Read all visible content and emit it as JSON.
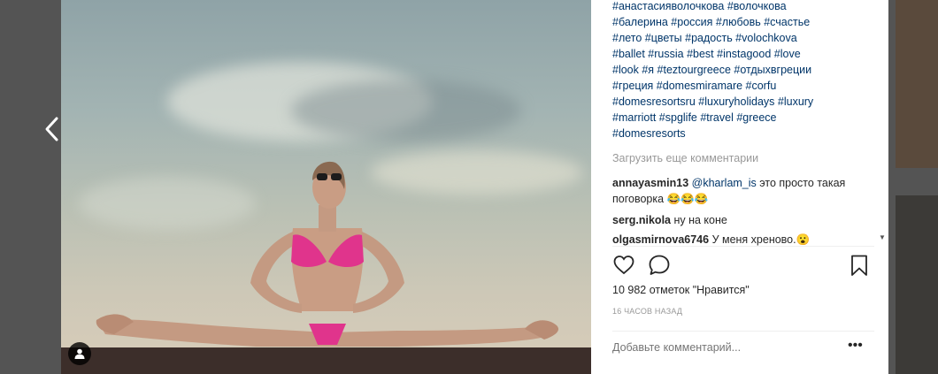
{
  "caption_lines": [
    "#анастасияволочкова #волочкова",
    "#балерина #россия #любовь #счастье",
    "#лето #цветы #радость #volochkova",
    "#ballet #russia #best #instagood #love",
    "#look #я #teztourgreece #отдыхвгреции",
    "#греция #domesmiramare #corfu",
    "#domesresortsru #luxuryholidays #luxury",
    "#marriott #spglife #travel #greece",
    "#domesresorts"
  ],
  "load_more": "Загрузить еще комментарии",
  "comments": [
    {
      "user": "annayasmin13",
      "mention": "@kharlam_is",
      "text": " это просто такая поговорка 😂😂😂"
    },
    {
      "user": "serg.nikola",
      "text": " ну на коне"
    },
    {
      "user": "olgasmirnova6746",
      "text": " У меня хреново.😮"
    }
  ],
  "likes": "10 982 отметок \"Нравится\"",
  "time": "16 ЧАСОВ НАЗАД",
  "add_comment_placeholder": "Добавьте комментарий...",
  "more_label": "•••",
  "icons": {
    "prev": "chevron-left-icon",
    "next": "chevron-right-icon",
    "like": "heart-icon",
    "comment": "speech-bubble-icon",
    "save": "bookmark-icon",
    "user_tag": "person-icon"
  },
  "colors": {
    "hashtag": "#003569",
    "text": "#262626",
    "muted": "#999999",
    "backdrop": "#545454"
  }
}
